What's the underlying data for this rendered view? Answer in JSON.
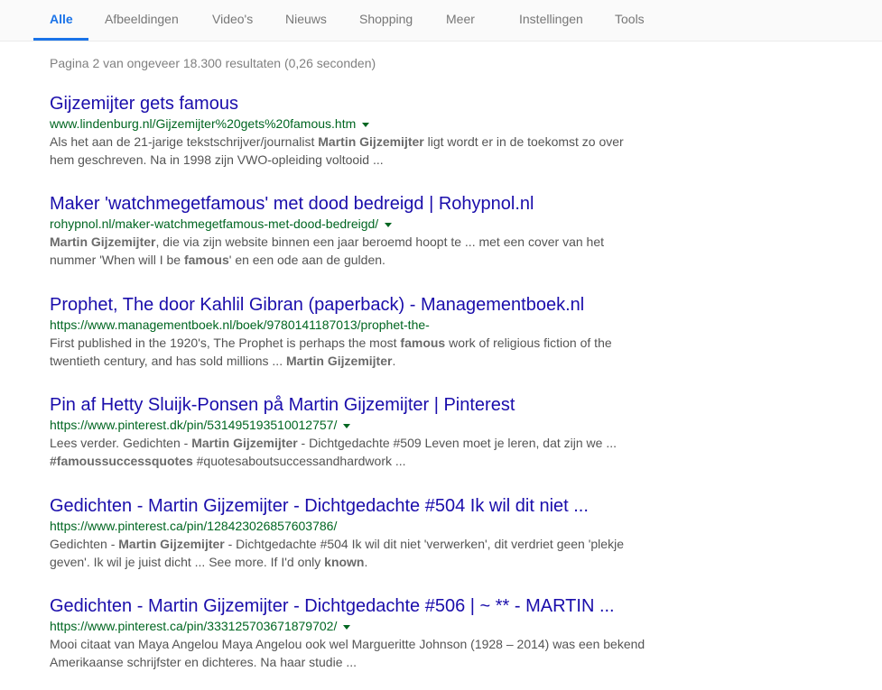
{
  "nav": {
    "tabs": [
      {
        "label": "Alle",
        "active": true
      },
      {
        "label": "Afbeeldingen"
      },
      {
        "label": "Video's"
      },
      {
        "label": "Nieuws"
      },
      {
        "label": "Shopping"
      },
      {
        "label": "Meer"
      }
    ],
    "settings": "Instellingen",
    "tools": "Tools"
  },
  "stats": "Pagina 2 van ongeveer 18.300 resultaten (0,26 seconden)",
  "results": [
    {
      "title": "Gijzemijter gets famous",
      "url": "www.lindenburg.nl/Gijzemijter%20gets%20famous.htm",
      "caret": true,
      "snippet": [
        [
          "Als het aan de 21-jarige tekstschrijver/journalist ",
          false
        ],
        [
          "Martin Gijzemijter",
          true
        ],
        [
          " ligt wordt er in de toekomst zo over hem geschreven. Na in 1998 zijn VWO-opleiding voltooid ...",
          false
        ]
      ]
    },
    {
      "title": "Maker 'watchmegetfamous' met dood bedreigd | Rohypnol.nl",
      "url": "rohypnol.nl/maker-watchmegetfamous-met-dood-bedreigd/",
      "caret": true,
      "snippet": [
        [
          "Martin Gijzemijter",
          true
        ],
        [
          ", die via zijn website binnen een jaar beroemd hoopt te ... met een cover van het nummer 'When will I be ",
          false
        ],
        [
          "famous",
          true
        ],
        [
          "' en een ode aan de gulden.",
          false
        ]
      ]
    },
    {
      "title": "Prophet, The door Kahlil Gibran (paperback) - Managementboek.nl",
      "url": "https://www.managementboek.nl/boek/9780141187013/prophet-the-",
      "caret": false,
      "snippet": [
        [
          "First published in the 1920's, The Prophet is perhaps the most ",
          false
        ],
        [
          "famous",
          true
        ],
        [
          " work of religious fiction of the twentieth century, and has sold millions ... ",
          false
        ],
        [
          "Martin Gijzemijter",
          true
        ],
        [
          ".",
          false
        ]
      ]
    },
    {
      "title": "Pin af Hetty Sluijk-Ponsen på Martin Gijzemijter | Pinterest",
      "url": "https://www.pinterest.dk/pin/531495193510012757/",
      "caret": true,
      "snippet": [
        [
          "Lees verder. Gedichten - ",
          false
        ],
        [
          "Martin Gijzemijter",
          true
        ],
        [
          " - Dichtgedachte #509 Leven moet je leren, dat zijn we ... ",
          false
        ],
        [
          "#famoussuccessquotes",
          true
        ],
        [
          " #quotesaboutsuccessandhardwork ...",
          false
        ]
      ]
    },
    {
      "title": "Gedichten - Martin Gijzemijter - Dichtgedachte #504 Ik wil dit niet ...",
      "url": "https://www.pinterest.ca/pin/128423026857603786/",
      "caret": false,
      "snippet": [
        [
          "Gedichten - ",
          false
        ],
        [
          "Martin Gijzemijter",
          true
        ],
        [
          " - Dichtgedachte #504 Ik wil dit niet 'verwerken', dit verdriet geen 'plekje geven'. Ik wil je juist dicht ... See more. If I'd only ",
          false
        ],
        [
          "known",
          true
        ],
        [
          ".",
          false
        ]
      ]
    },
    {
      "title": "Gedichten - Martin Gijzemijter - Dichtgedachte #506 | ~ ** - MARTIN ...",
      "url": "https://www.pinterest.ca/pin/333125703671879702/",
      "caret": true,
      "snippet": [
        [
          "Mooi citaat van Maya Angelou Maya Angelou ook wel Margueritte Johnson (1928 – 2014) was een bekend Amerikaanse schrijfster en dichteres. Na haar studie ...",
          false
        ]
      ]
    }
  ]
}
